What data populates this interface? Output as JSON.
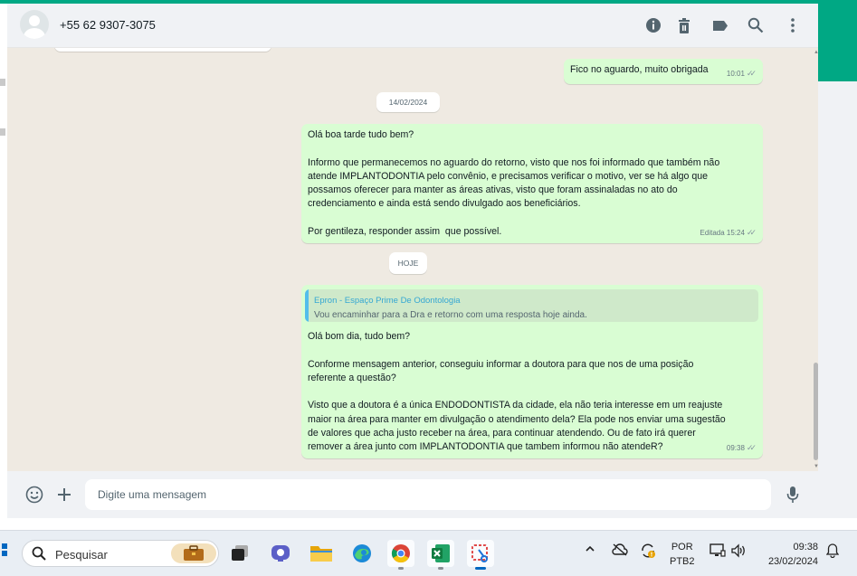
{
  "header": {
    "contact_name": "+55 62 9307-3075",
    "icons": [
      "info-icon",
      "trash-icon",
      "label-icon",
      "search-icon",
      "menu-icon"
    ]
  },
  "chat": {
    "messages": [
      {
        "type": "outgoing",
        "text": "Fico no aguardo, muito obrigada",
        "time": "10:01",
        "status": "read"
      },
      {
        "type": "date",
        "text": "14/02/2024"
      },
      {
        "type": "outgoing",
        "text": "Olá boa tarde tudo bem?\n\nInformo que permanecemos no aguardo do retorno, visto que nos foi informado que também não\natende IMPLANTODONTIA pelo convênio, e precisamos verificar o motivo, ver se há algo que\npossamos oferecer para manter as áreas ativas, visto que foram assinaladas no ato do\ncredenciamento e ainda está sendo divulgado aos beneficiários.\n\nPor gentileza, responder assim  que possível.",
        "time": "Editada 15:24",
        "status": "read"
      },
      {
        "type": "date",
        "text": "HOJE"
      },
      {
        "type": "outgoing",
        "quote_author": "Epron - Espaço Prime De Odontologia",
        "quote_text": "Vou encaminhar para a Dra e retorno com uma resposta hoje ainda.",
        "text": "Olá bom dia, tudo bem?\n\nConforme mensagem anterior, conseguiu informar a doutora para que nos de uma posição\nreferente a questão?\n\nVisto que a doutora é a única ENDODONTISTA da cidade, ela não teria interesse em um reajuste\nmaior na área para manter em divulgação o atendimento dela? Ela pode nos enviar uma sugestão\nde valores que acha justo receber na área, para continuar atendendo. Ou de fato irá querer\nremover a área junto com IMPLANTODONTIA que tambem informou não atendeR?",
        "time": "09:38",
        "status": "read"
      }
    ]
  },
  "compose": {
    "placeholder": "Digite uma mensagem"
  },
  "taskbar": {
    "search_label": "Pesquisar",
    "apps": [
      "task-view-icon",
      "teams-icon",
      "file-explorer-icon",
      "edge-icon",
      "chrome-icon",
      "excel-icon",
      "snipping-tool-icon"
    ],
    "language_top": "POR",
    "language_bottom": "PTB2",
    "time": "09:38",
    "date": "23/02/2024"
  }
}
